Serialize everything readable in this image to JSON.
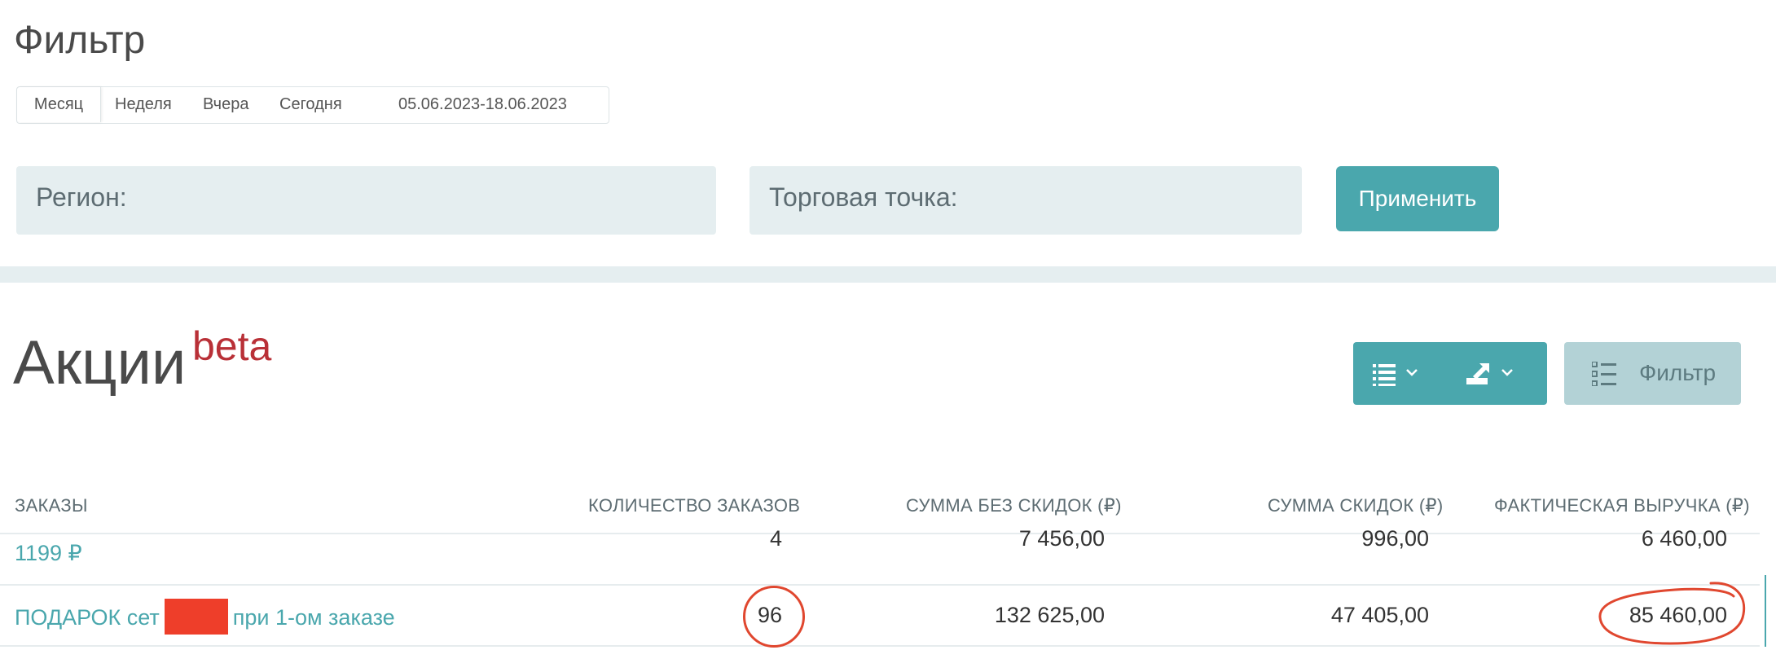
{
  "filter": {
    "title": "Фильтр",
    "period_buttons": [
      "Месяц",
      "Неделя",
      "Вчера",
      "Сегодня"
    ],
    "active_period": "Месяц",
    "date_range": "05.06.2023-18.06.2023",
    "region_label": "Регион:",
    "store_label": "Торговая точка:",
    "apply_label": "Применить"
  },
  "promo": {
    "title": "Акции",
    "badge": "beta",
    "filter_button_label": "Фильтр",
    "icons": {
      "list": "list-icon",
      "export": "export-icon",
      "chevron": "chevron-down-icon",
      "filter": "filter-list-icon"
    }
  },
  "table": {
    "columns": [
      "ЗАКАЗЫ",
      "КОЛИЧЕСТВО ЗАКАЗОВ",
      "СУММА БЕЗ СКИДОК (₽)",
      "СУММА СКИДОК (₽)",
      "ФАКТИЧЕСКАЯ ВЫРУЧКА (₽)"
    ],
    "rows": [
      {
        "name": "1199 ₽",
        "orders": "4",
        "sum_no_discount": "7 456,00",
        "discount_sum": "996,00",
        "revenue": "6 460,00"
      },
      {
        "name_prefix": "ПОДАРОК сет",
        "name_suffix": "при 1-ом заказе",
        "orders": "96",
        "sum_no_discount": "132 625,00",
        "discount_sum": "47 405,00",
        "revenue": "85 460,00"
      }
    ]
  },
  "colors": {
    "accent": "#4aa7ad",
    "accent_light": "#b3d2d6",
    "beta": "#b93037",
    "annotation": "#e0472f",
    "redaction": "#ee3e2a"
  }
}
